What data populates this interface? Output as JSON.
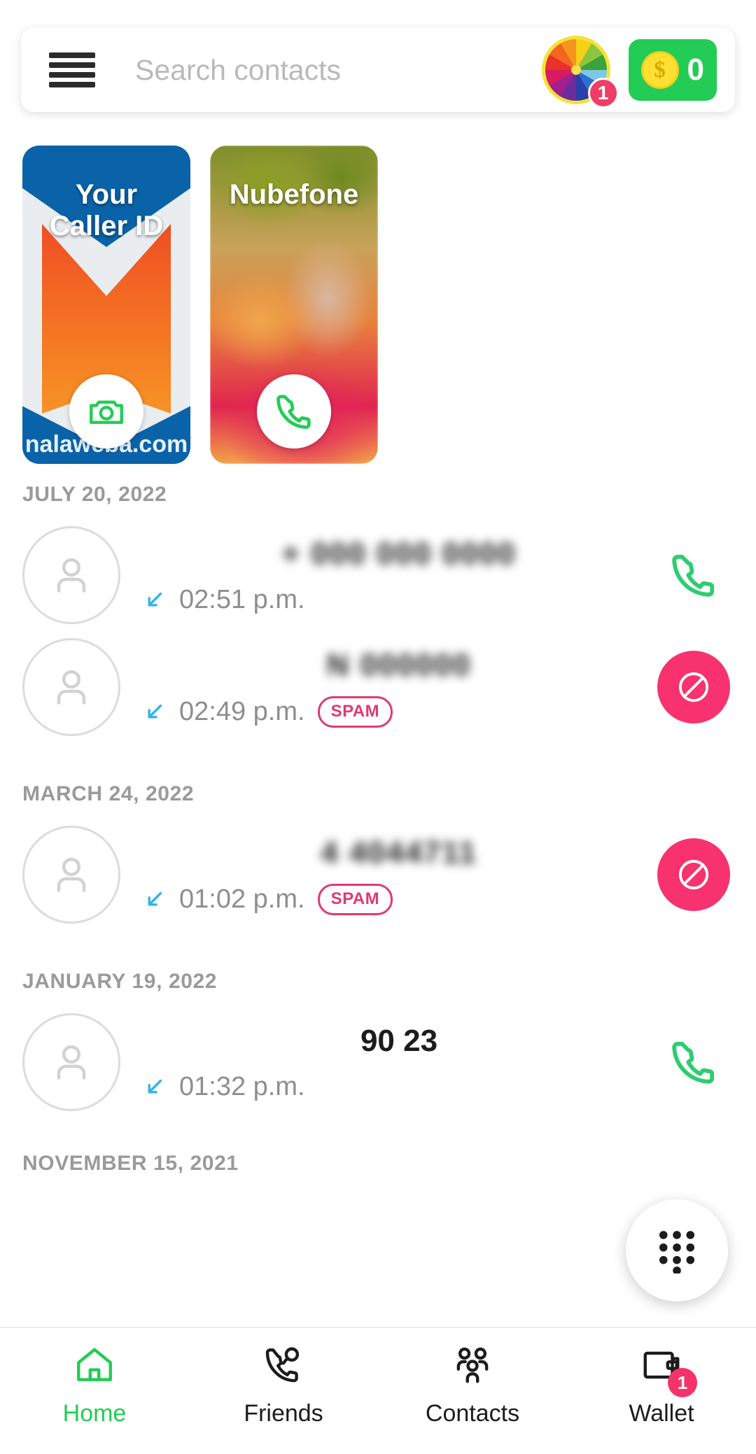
{
  "search": {
    "placeholder": "Search contacts",
    "value": "",
    "menu_icon": "hamburger-menu-icon",
    "wheel_icon": "spin-wheel-icon",
    "wheel_badge": "1",
    "coin_icon": "dollar-coin-icon",
    "coin_count": "0"
  },
  "cards": [
    {
      "title": "Your\nCaller ID",
      "title_line1": "Your",
      "title_line2": "Caller ID",
      "watermark": "nalaweba.com",
      "action_icon": "camera-icon",
      "kind": "caller-id"
    },
    {
      "title": "Nubefone",
      "title_line1": "Nubefone",
      "title_line2": "",
      "watermark": "",
      "action_icon": "phone-icon",
      "kind": "photo"
    }
  ],
  "call_log": [
    {
      "date": "JULY 20, 2022",
      "calls": [
        {
          "number": "+ 000 000 0000",
          "redacted": true,
          "direction_icon": "incoming-call-arrow-icon",
          "time": "02:51 p.m.",
          "spam": "",
          "is_spam": false,
          "action_icon": "phone-call-icon",
          "action_type": "call"
        },
        {
          "number": "N 000000",
          "redacted": true,
          "direction_icon": "incoming-call-arrow-icon",
          "time": "02:49 p.m.",
          "spam": "SPAM",
          "is_spam": true,
          "action_icon": "block-icon",
          "action_type": "block"
        }
      ]
    },
    {
      "date": "MARCH 24, 2022",
      "calls": [
        {
          "number": "4 4044711",
          "redacted": true,
          "direction_icon": "incoming-call-arrow-icon",
          "time": "01:02 p.m.",
          "spam": "SPAM",
          "is_spam": true,
          "action_icon": "block-icon",
          "action_type": "block"
        }
      ]
    },
    {
      "date": "JANUARY 19, 2022",
      "calls": [
        {
          "number": "90 23",
          "redacted": false,
          "direction_icon": "incoming-call-arrow-icon",
          "time": "01:32 p.m.",
          "spam": "",
          "is_spam": false,
          "action_icon": "phone-call-icon",
          "action_type": "call"
        }
      ]
    },
    {
      "date": "NOVEMBER 15, 2021",
      "calls": []
    }
  ],
  "dial_fab": {
    "icon": "dialpad-icon"
  },
  "bottom_nav": [
    {
      "label": "Home",
      "icon": "home-icon",
      "active": true,
      "badge": ""
    },
    {
      "label": "Friends",
      "icon": "friends-call-icon",
      "active": false,
      "badge": ""
    },
    {
      "label": "Contacts",
      "icon": "contacts-group-icon",
      "active": false,
      "badge": ""
    },
    {
      "label": "Wallet",
      "icon": "wallet-icon",
      "active": false,
      "badge": "1"
    }
  ],
  "colors": {
    "accent_green": "#22cc55",
    "spam_pink": "#e03a72",
    "block_pink": "#f8326e",
    "badge_pink": "#f4336d",
    "incoming_blue": "#34b3e8",
    "muted_gray": "#9a9a9a"
  }
}
